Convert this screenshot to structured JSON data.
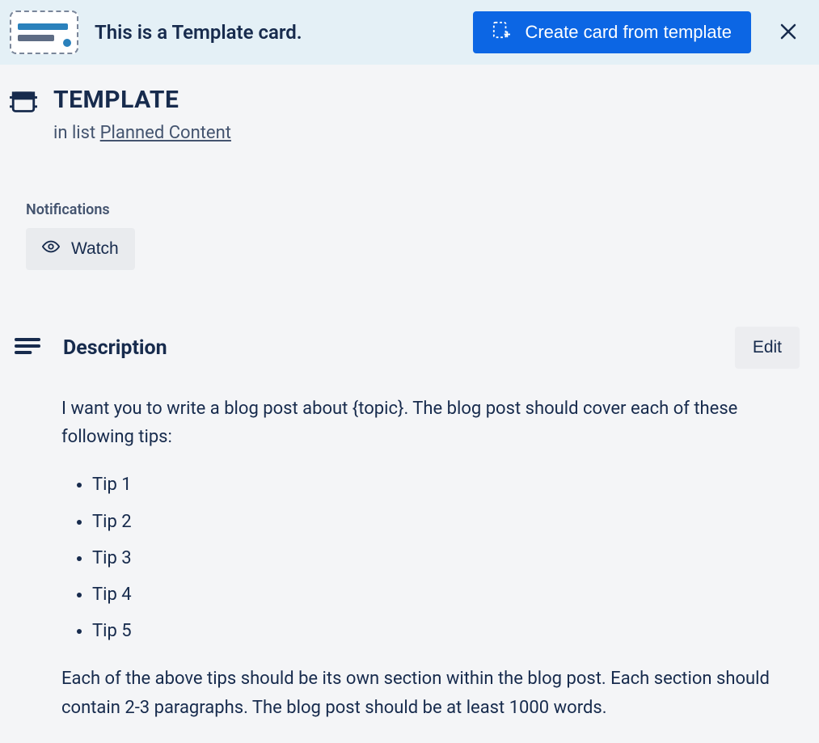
{
  "banner": {
    "text": "This is a Template card.",
    "create_button": "Create card from template"
  },
  "card": {
    "title": "TEMPLATE",
    "in_list_prefix": "in list ",
    "list_name": "Planned Content"
  },
  "notifications": {
    "label": "Notifications",
    "watch_button": "Watch"
  },
  "description": {
    "heading": "Description",
    "edit_button": "Edit",
    "intro": "I want you to write a blog post about {topic}. The blog post should cover each of these following tips:",
    "tips": [
      "Tip 1",
      "Tip 2",
      "Tip 3",
      "Tip 4",
      "Tip 5"
    ],
    "outro": "Each of the above tips should be its own section within the blog post. Each section should contain 2-3 paragraphs. The blog post should be at least 1000 words."
  }
}
